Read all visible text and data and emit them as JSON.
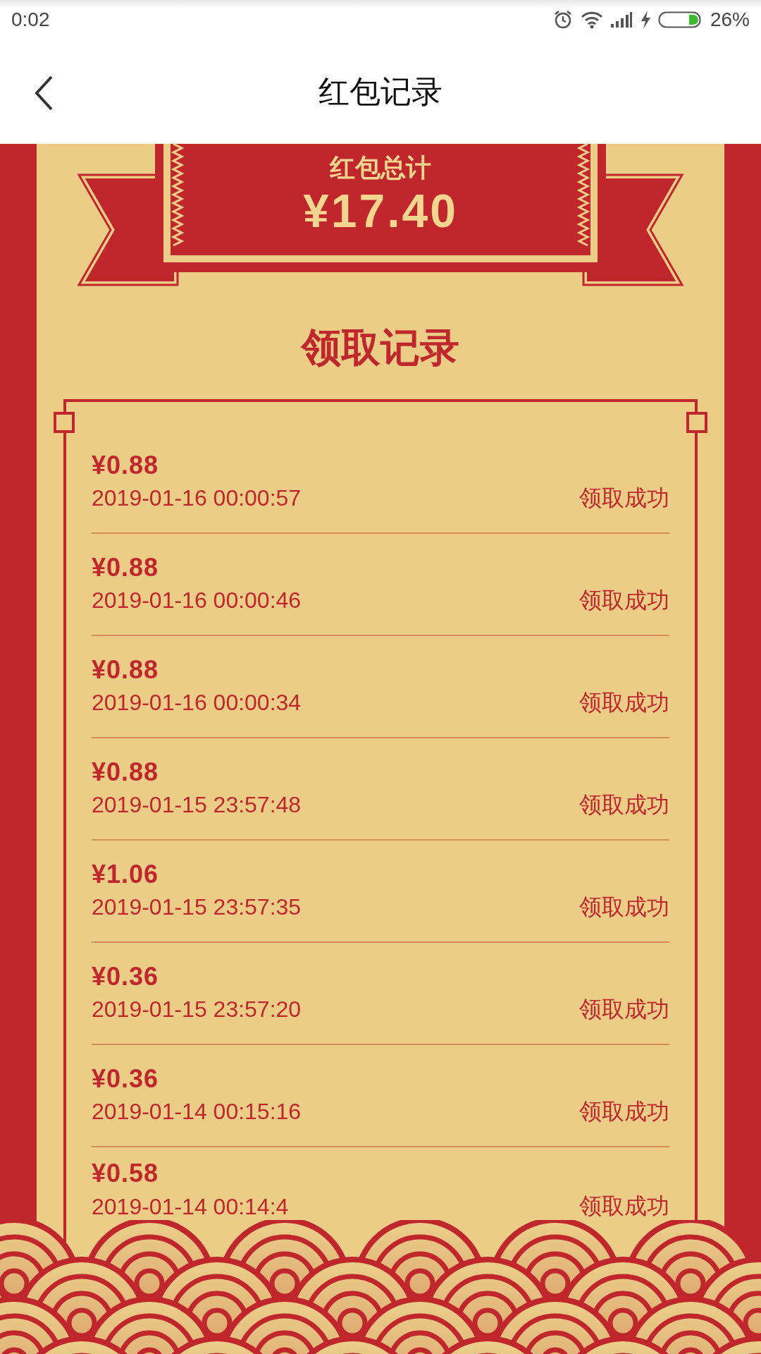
{
  "status_bar": {
    "time": "0:02",
    "battery_percent": "26%"
  },
  "header": {
    "title": "红包记录"
  },
  "summary": {
    "label": "红包总计",
    "total": "¥17.40"
  },
  "records": {
    "heading": "领取记录",
    "items": [
      {
        "amount": "¥0.88",
        "time": "2019-01-16 00:00:57",
        "status": "领取成功"
      },
      {
        "amount": "¥0.88",
        "time": "2019-01-16 00:00:46",
        "status": "领取成功"
      },
      {
        "amount": "¥0.88",
        "time": "2019-01-16 00:00:34",
        "status": "领取成功"
      },
      {
        "amount": "¥0.88",
        "time": "2019-01-15 23:57:48",
        "status": "领取成功"
      },
      {
        "amount": "¥1.06",
        "time": "2019-01-15 23:57:35",
        "status": "领取成功"
      },
      {
        "amount": "¥0.36",
        "time": "2019-01-15 23:57:20",
        "status": "领取成功"
      },
      {
        "amount": "¥0.36",
        "time": "2019-01-14 00:15:16",
        "status": "领取成功"
      },
      {
        "amount": "¥0.58",
        "time": "2019-01-14 00:14:4",
        "status": "领取成功"
      }
    ]
  }
}
